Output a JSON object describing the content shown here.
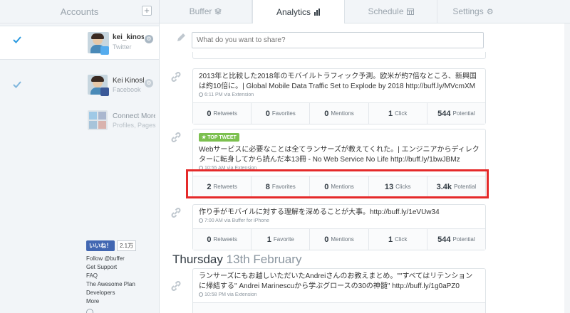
{
  "sidebar": {
    "header": "Accounts",
    "add_label": "+",
    "accounts": [
      {
        "name": "kei_kinoshi",
        "network": "Twitter"
      },
      {
        "name": "Kei Kinoshi",
        "network": "Facebook"
      },
      {
        "name": "Connect More",
        "network": "Profiles, Pages"
      }
    ],
    "fb_like": "いいね！",
    "fb_count": "2.1万",
    "links": [
      "Follow @buffer",
      "Get Support",
      "FAQ",
      "The Awesome Plan",
      "Developers",
      "More"
    ]
  },
  "tabs": [
    {
      "label": "Buffer",
      "icon": "stack-icon"
    },
    {
      "label": "Analytics",
      "icon": "bar-chart-icon"
    },
    {
      "label": "Schedule",
      "icon": "calendar-icon"
    },
    {
      "label": "Settings",
      "icon": "gear-icon"
    }
  ],
  "composer": {
    "placeholder": "What do you want to share?"
  },
  "posts": [
    {
      "text": "2013年と比較した2018年のモバイルトラフィック予測。欧米が約7倍なところ、新興国は約10倍に。| Global Mobile Data Traffic Set to Explode by 2018 http://buff.ly/MVcmXM",
      "time": "6:11 PM",
      "via": "via Extension",
      "stats": [
        {
          "num": "0",
          "label": "Retweets"
        },
        {
          "num": "0",
          "label": "Favorites"
        },
        {
          "num": "0",
          "label": "Mentions"
        },
        {
          "num": "1",
          "label": "Click"
        },
        {
          "num": "544",
          "label": "Potential"
        }
      ]
    },
    {
      "badge": "TOP TWEET",
      "text": "Webサービスに必要なことは全てランサーズが教えてくれた。| エンジニアからディレクターに転身してから読んだ本13冊 - No Web Service No Life http://buff.ly/1bwJBMz",
      "time": "10:55 AM",
      "via": "via Extension",
      "stats": [
        {
          "num": "2",
          "label": "Retweets"
        },
        {
          "num": "8",
          "label": "Favorites"
        },
        {
          "num": "0",
          "label": "Mentions"
        },
        {
          "num": "13",
          "label": "Clicks"
        },
        {
          "num": "3.4k",
          "label": "Potential"
        }
      ]
    },
    {
      "text": "作り手がモバイルに対する理解を深めることが大事。http://buff.ly/1eVUw34",
      "time": "7:00 AM",
      "via": "via Buffer for iPhone",
      "stats": [
        {
          "num": "0",
          "label": "Retweets"
        },
        {
          "num": "1",
          "label": "Favorite"
        },
        {
          "num": "0",
          "label": "Mentions"
        },
        {
          "num": "1",
          "label": "Click"
        },
        {
          "num": "544",
          "label": "Potential"
        }
      ]
    },
    {
      "text": "ランサーズにもお越しいただいたAndreiさんのお教えまとめ。\"\"すべてはリテンションに帰結する\" Andrei Marinescuから学ぶグロースの30の神髄\" http://buff.ly/1g0aPZ0",
      "time": "10:58 PM",
      "via": "via Extension"
    }
  ],
  "day_header": {
    "day": "Thursday",
    "date": "13th February"
  },
  "colors": {
    "accent": "#2c9ae0",
    "highlight": "#e52a2a",
    "top_tweet": "#7cc04f"
  }
}
